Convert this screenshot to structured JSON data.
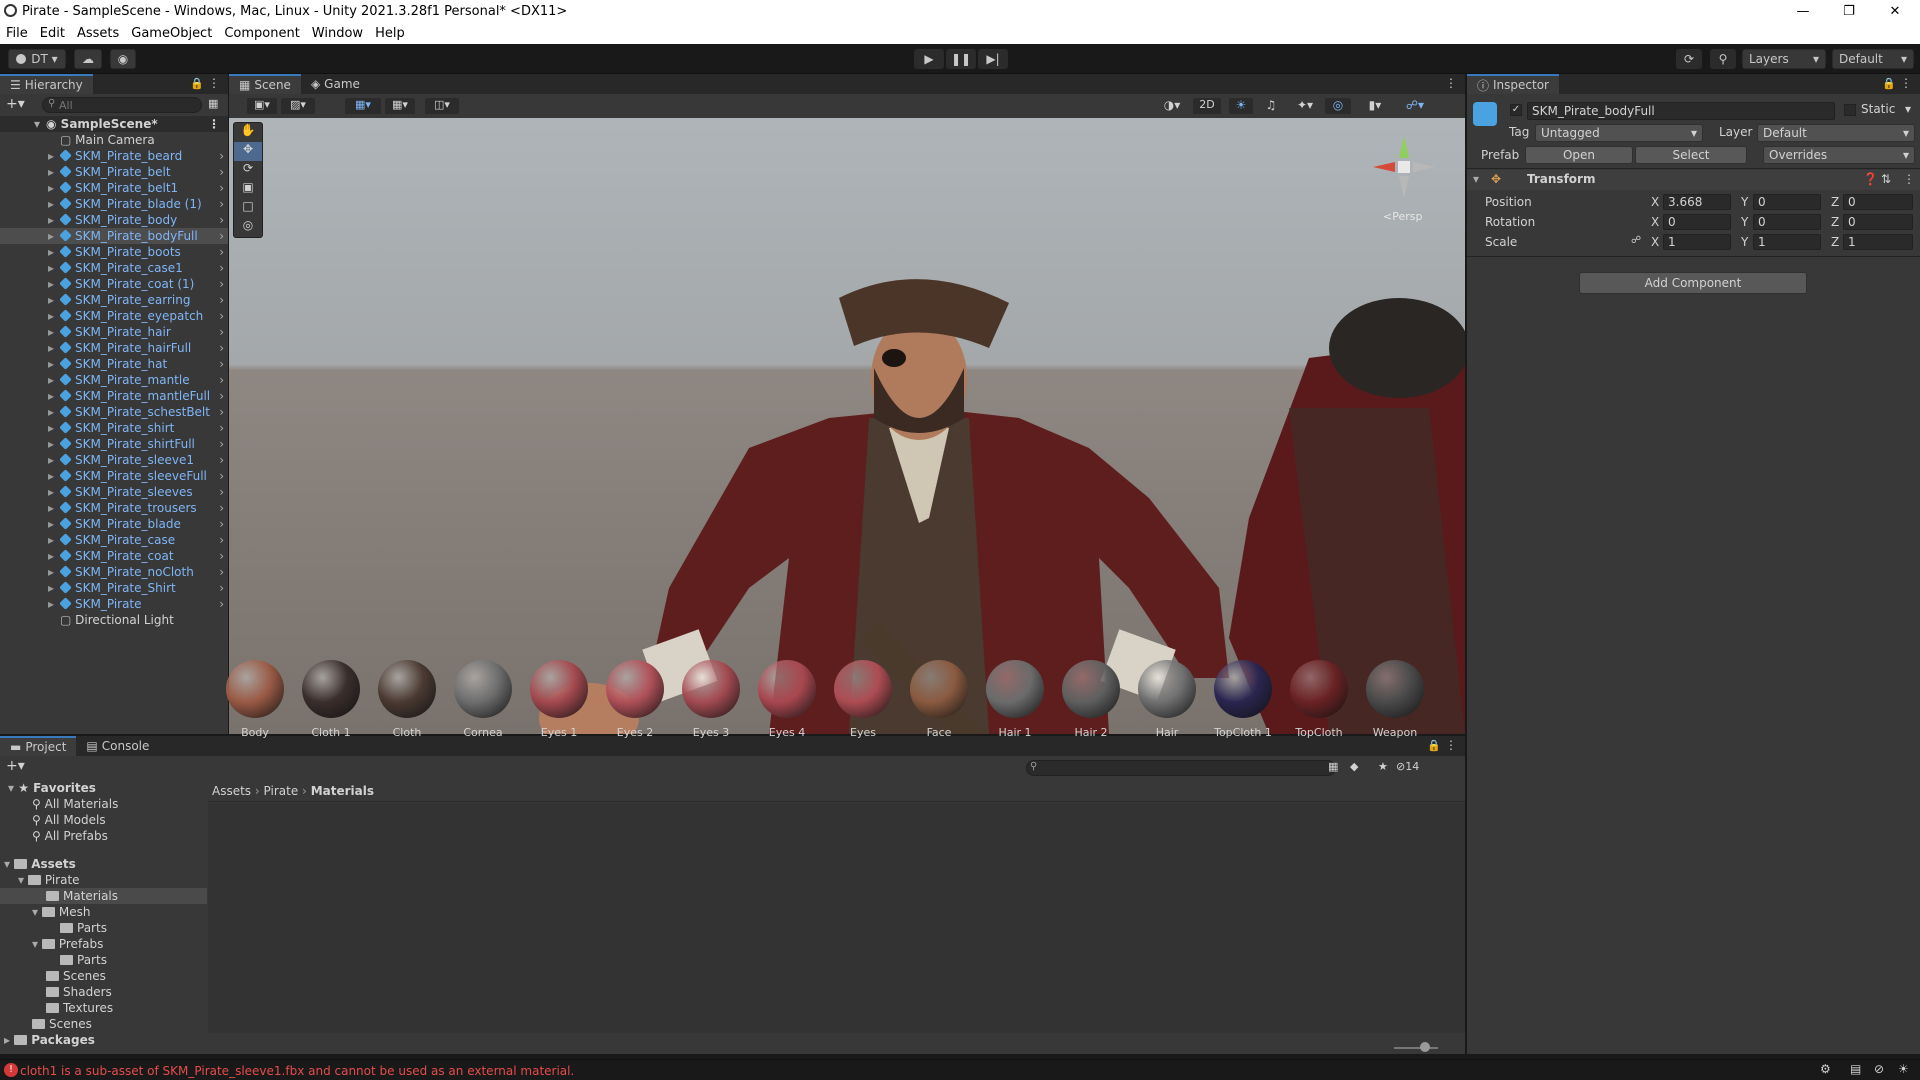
{
  "window": {
    "title": "Pirate - SampleScene - Windows, Mac, Linux - Unity 2021.3.28f1 Personal* <DX11>"
  },
  "menu": [
    "File",
    "Edit",
    "Assets",
    "GameObject",
    "Component",
    "Window",
    "Help"
  ],
  "toolbar": {
    "account": "DT",
    "layers": "Layers",
    "layout": "Default"
  },
  "hierarchy": {
    "tab": "Hierarchy",
    "search_placeholder": "All",
    "scene": "SampleScene*",
    "items": [
      {
        "label": "Main Camera",
        "prefab": false
      },
      {
        "label": "SKM_Pirate_beard",
        "prefab": true
      },
      {
        "label": "SKM_Pirate_belt",
        "prefab": true
      },
      {
        "label": "SKM_Pirate_belt1",
        "prefab": true
      },
      {
        "label": "SKM_Pirate_blade (1)",
        "prefab": true
      },
      {
        "label": "SKM_Pirate_body",
        "prefab": true
      },
      {
        "label": "SKM_Pirate_bodyFull",
        "prefab": true,
        "selected": true
      },
      {
        "label": "SKM_Pirate_boots",
        "prefab": true
      },
      {
        "label": "SKM_Pirate_case1",
        "prefab": true
      },
      {
        "label": "SKM_Pirate_coat (1)",
        "prefab": true
      },
      {
        "label": "SKM_Pirate_earring",
        "prefab": true
      },
      {
        "label": "SKM_Pirate_eyepatch",
        "prefab": true
      },
      {
        "label": "SKM_Pirate_hair",
        "prefab": true
      },
      {
        "label": "SKM_Pirate_hairFull",
        "prefab": true
      },
      {
        "label": "SKM_Pirate_hat",
        "prefab": true
      },
      {
        "label": "SKM_Pirate_mantle",
        "prefab": true
      },
      {
        "label": "SKM_Pirate_mantleFull",
        "prefab": true
      },
      {
        "label": "SKM_Pirate_schestBelt",
        "prefab": true
      },
      {
        "label": "SKM_Pirate_shirt",
        "prefab": true
      },
      {
        "label": "SKM_Pirate_shirtFull",
        "prefab": true
      },
      {
        "label": "SKM_Pirate_sleeve1",
        "prefab": true
      },
      {
        "label": "SKM_Pirate_sleeveFull",
        "prefab": true
      },
      {
        "label": "SKM_Pirate_sleeves",
        "prefab": true
      },
      {
        "label": "SKM_Pirate_trousers",
        "prefab": true
      },
      {
        "label": "SKM_Pirate_blade",
        "prefab": true
      },
      {
        "label": "SKM_Pirate_case",
        "prefab": true
      },
      {
        "label": "SKM_Pirate_coat",
        "prefab": true
      },
      {
        "label": "SKM_Pirate_noCloth",
        "prefab": true
      },
      {
        "label": "SKM_Pirate_Shirt",
        "prefab": true
      },
      {
        "label": "SKM_Pirate",
        "prefab": true
      },
      {
        "label": "Directional Light",
        "prefab": false
      }
    ]
  },
  "scene_view": {
    "tabs": [
      "Scene",
      "Game"
    ],
    "mode_2d": "2D",
    "persp_label": "<Persp"
  },
  "inspector": {
    "tab": "Inspector",
    "object_name": "SKM_Pirate_bodyFull",
    "static_label": "Static",
    "tag_label": "Tag",
    "tag_value": "Untagged",
    "layer_label": "Layer",
    "layer_value": "Default",
    "prefab_label": "Prefab",
    "open": "Open",
    "select": "Select",
    "overrides": "Overrides",
    "transform_title": "Transform",
    "position_label": "Position",
    "rotation_label": "Rotation",
    "scale_label": "Scale",
    "position": {
      "x": "3.668",
      "y": "0",
      "z": "0"
    },
    "rotation": {
      "x": "0",
      "y": "0",
      "z": "0"
    },
    "scale": {
      "x": "1",
      "y": "1",
      "z": "1"
    },
    "axis": {
      "x": "X",
      "y": "Y",
      "z": "Z"
    },
    "add_component": "Add Component"
  },
  "project": {
    "tabs": [
      "Project",
      "Console"
    ],
    "favorites": "Favorites",
    "fav_items": [
      "All Materials",
      "All Models",
      "All Prefabs"
    ],
    "assets": "Assets",
    "tree": {
      "pirate": "Pirate",
      "materials": "Materials",
      "mesh": "Mesh",
      "parts1": "Parts",
      "prefabs": "Prefabs",
      "parts2": "Parts",
      "scenes_sub": "Scenes",
      "shaders": "Shaders",
      "textures": "Textures",
      "scenes": "Scenes",
      "packages": "Packages"
    },
    "breadcrumb": [
      "Assets",
      "Pirate",
      "Materials"
    ],
    "hidden_count": "14",
    "materials": [
      {
        "name": "Body",
        "color": "#9a5a45"
      },
      {
        "name": "Cloth 1",
        "color": "#3a2e2c"
      },
      {
        "name": "Cloth",
        "color": "#4a3a32"
      },
      {
        "name": "Cornea",
        "color": "#6d6d6d"
      },
      {
        "name": "Eyes 1",
        "color": "#a3494f"
      },
      {
        "name": "Eyes 2",
        "color": "#b05058"
      },
      {
        "name": "Eyes 3",
        "color": "#a44b52"
      },
      {
        "name": "Eyes 4",
        "color": "#a8474f"
      },
      {
        "name": "Eyes",
        "color": "#ad4c53"
      },
      {
        "name": "Face",
        "color": "#8a5a40"
      },
      {
        "name": "Hair 1",
        "color": "#6b6b6b"
      },
      {
        "name": "Hair 2",
        "color": "#5f5f5f"
      },
      {
        "name": "Hair",
        "color": "#707070"
      },
      {
        "name": "TopCloth 1",
        "color": "#2a2550"
      },
      {
        "name": "TopCloth",
        "color": "#6a2224"
      },
      {
        "name": "Weapon",
        "color": "#4a4a4a"
      }
    ]
  },
  "status": {
    "error": "cloth1 is a sub-asset of SKM_Pirate_sleeve1.fbx and cannot be used as an external material."
  }
}
